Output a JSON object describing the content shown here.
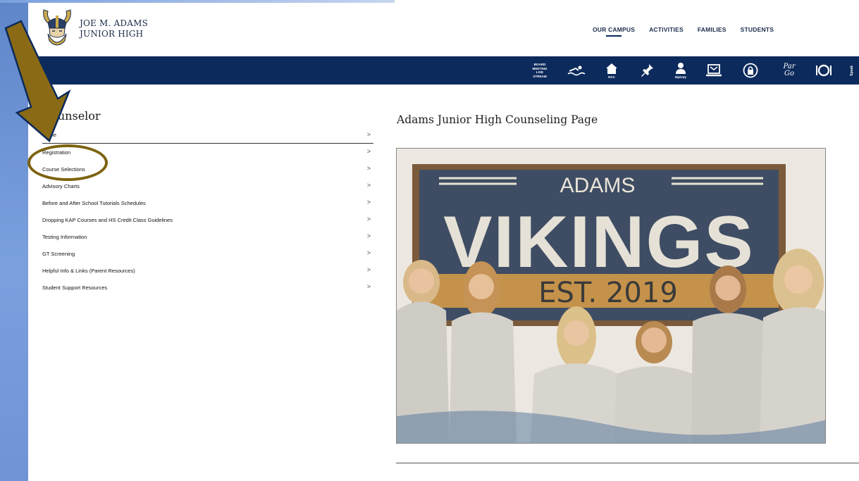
{
  "header": {
    "school_name_line1": "JOE M. ADAMS",
    "school_name_line2": "JUNIOR HIGH",
    "logo_icon": "viking-mascot-icon"
  },
  "top_nav": [
    {
      "label": "OUR CAMPUS",
      "active": true
    },
    {
      "label": "ACTIVITIES",
      "active": false
    },
    {
      "label": "FAMILIES",
      "active": false
    },
    {
      "label": "STUDENTS",
      "active": false
    }
  ],
  "quick_links": {
    "board_meeting": "BOARD MEETING LIVE STREAM",
    "rac_caption": "RAC",
    "mykaty_caption": "MyKaty",
    "pargo": "Par Go",
    "speak_up": "Speak"
  },
  "sidebar": {
    "title": "Counselor",
    "items": [
      {
        "label": "Home"
      },
      {
        "label": "Registration"
      },
      {
        "label": "Course Selections"
      },
      {
        "label": "Advisory Charts"
      },
      {
        "label": "Before and After School Tutorials Schedules"
      },
      {
        "label": "Dropping KAP Courses and HS Credit Class Guidelines"
      },
      {
        "label": "Testing Information"
      },
      {
        "label": "GT Screening"
      },
      {
        "label": "Helpful Info & Links (Parent Resources)"
      },
      {
        "label": "Student Support Resources"
      }
    ],
    "chevron": ">"
  },
  "main": {
    "heading": "Adams Junior High Counseling Page",
    "photo": {
      "sign_top": "ADAMS",
      "sign_main": "VIKINGS",
      "sign_est": "EST. 2019"
    }
  },
  "colors": {
    "navy": "#0c2a5c",
    "annotation_arrow": "#8a6a14",
    "annotation_oval": "#7d6210",
    "left_band": "#6f94d6"
  }
}
